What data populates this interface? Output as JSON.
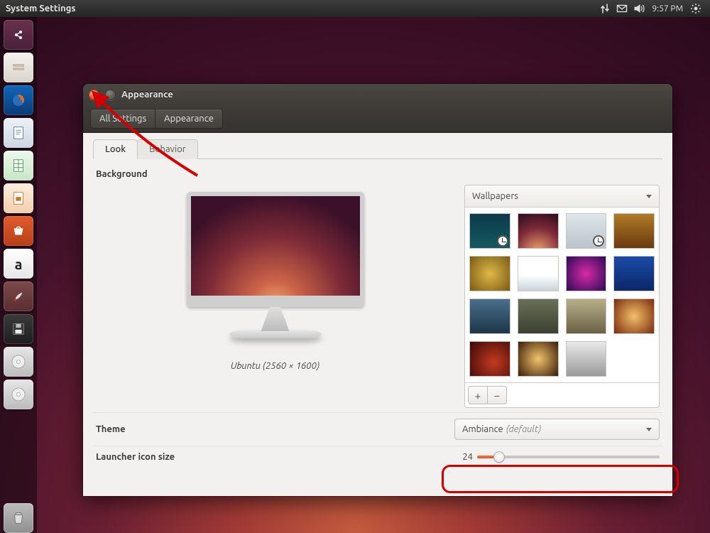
{
  "menubar": {
    "title": "System Settings",
    "clock": "9:57 PM"
  },
  "launcher": {
    "items": [
      {
        "name": "dash",
        "bg": "linear-gradient(#6b3049,#48203a)"
      },
      {
        "name": "files",
        "bg": "linear-gradient(#f6f3ef,#d8d4cc)"
      },
      {
        "name": "firefox",
        "bg": "linear-gradient(#1266b8,#0a3a74)"
      },
      {
        "name": "writer",
        "bg": "linear-gradient(#eef2f7,#cdd6e2)"
      },
      {
        "name": "calc",
        "bg": "linear-gradient(#edf7ed,#c9e6c9)"
      },
      {
        "name": "impress",
        "bg": "linear-gradient(#fceee0,#f2ceae)"
      },
      {
        "name": "software",
        "bg": "linear-gradient(#e25b2c,#b53f17)"
      },
      {
        "name": "amazon",
        "bg": "linear-gradient(#ffffff,#e6e6e6)"
      },
      {
        "name": "settings",
        "bg": "linear-gradient(#7b4a4a,#5a2f2f)"
      },
      {
        "name": "floppy",
        "bg": "linear-gradient(#3a3a3a,#1e1e1e)"
      },
      {
        "name": "disc1",
        "bg": "linear-gradient(#e7e7e7,#bcbcbc)"
      },
      {
        "name": "disc2",
        "bg": "linear-gradient(#e7e7e7,#bcbcbc)"
      }
    ]
  },
  "window": {
    "title": "Appearance",
    "breadcrumbs": [
      "All Settings",
      "Appearance"
    ],
    "tabs": {
      "look": "Look",
      "behavior": "Behavior"
    },
    "background": {
      "label": "Background",
      "caption": "Ubuntu (2560 × 1600)",
      "source_label": "Wallpapers",
      "thumbs": [
        {
          "bg": "linear-gradient(#0b3a4a,#155a5f)",
          "clock": true,
          "selected": false
        },
        {
          "bg": "radial-gradient(circle at 50% 110%,#f2a46f,#7c2a37 55%,#2d0b1f)",
          "clock": false,
          "selected": false
        },
        {
          "bg": "linear-gradient(#dfe6ea,#b9c4cb)",
          "clock": true,
          "selected": false
        },
        {
          "bg": "linear-gradient(#b07a28,#6a3b0d)",
          "clock": false,
          "selected": false
        },
        {
          "bg": "radial-gradient(circle,#e0b84a,#7a5a12)",
          "clock": false,
          "selected": false
        },
        {
          "bg": "linear-gradient(#ffffff 55%,#c9d1d7)",
          "clock": false,
          "selected": false
        },
        {
          "bg": "radial-gradient(circle,#d82aa8,#2a0a55)",
          "clock": false,
          "selected": false
        },
        {
          "bg": "linear-gradient(#1a4aa8,#0b2766)",
          "clock": false,
          "selected": false
        },
        {
          "bg": "linear-gradient(#4a6f8c,#1d3547)",
          "clock": false,
          "selected": false
        },
        {
          "bg": "linear-gradient(#6a6f58,#3b4030)",
          "clock": false,
          "selected": false
        },
        {
          "bg": "linear-gradient(#b8af8a,#6a6146)",
          "clock": false,
          "selected": false
        },
        {
          "bg": "radial-gradient(circle,#f4c16a,#7a2a0d)",
          "clock": false,
          "selected": false
        },
        {
          "bg": "radial-gradient(circle at 60% 60%,#c23a1f,#3a0808)",
          "clock": false,
          "selected": false
        },
        {
          "bg": "radial-gradient(circle,#f2c46a,#3a1a08)",
          "clock": false,
          "selected": false
        },
        {
          "bg": "linear-gradient(#e8e8e8,#9a9a9a)",
          "clock": false,
          "selected": false
        }
      ],
      "add": "+",
      "remove": "−"
    },
    "theme": {
      "label": "Theme",
      "value": "Ambiance",
      "suffix": "(default)"
    },
    "launcher_size": {
      "label": "Launcher icon size",
      "value": "24"
    }
  }
}
